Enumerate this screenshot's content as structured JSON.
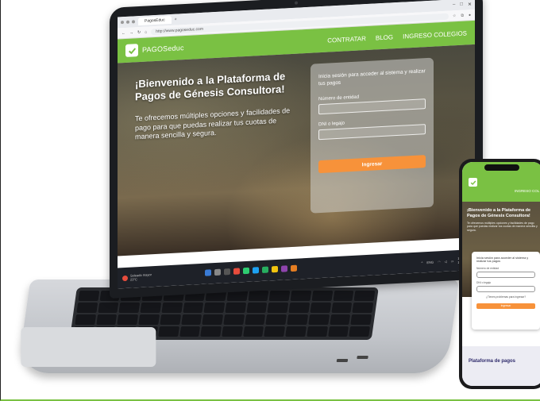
{
  "browser": {
    "tab_label": "PagosEduc",
    "url": "http://www.pagoseduc.com"
  },
  "site": {
    "logo_text": "PAGOSeduc",
    "nav": [
      "CONTRATAR",
      "BLOG",
      "INGRESO COLEGIOS"
    ]
  },
  "hero": {
    "heading": "¡Bienvenido a la Plataforma de Pagos de Génesis Consultora!",
    "text": "Te ofrecemos múltiples opciones y facilidades de pago para que puedas realizar tus cuotas de manera sencilla y segura."
  },
  "login": {
    "intro": "Inicia sesión para acceder al sistema y realizar tus pagos",
    "field_entity": "Número de entidad",
    "field_dni": "DNI o legajo",
    "button": "Ingresar"
  },
  "taskbar": {
    "weather_title": "Soleado mayor",
    "weather_temp": "23°C",
    "lang": "ENG",
    "time": "15:",
    "date": "16/10/20"
  },
  "phone": {
    "menu": "INGRESO COL",
    "heading": "¡Bienvenido a la Plataforma de Pagos de Génesis Consultora!",
    "text": "Te ofrecemos múltiples opciones y facilidades de pago para que puedas realizar tus cuotas de manera sencilla y segura.",
    "card_intro": "Inicia sesión para acceder al sistema y realizar tus pagos",
    "field_entity": "Número de entidad",
    "field_dni": "DNI o legajo",
    "forgot": "¿Tienes problemas para ingresar?",
    "button": "Ingresar",
    "footer": "Plataforma de pagos"
  },
  "colors": {
    "brand_green": "#7ac143",
    "button_orange": "#f7923a",
    "footer_navy": "#2e2a6b"
  }
}
